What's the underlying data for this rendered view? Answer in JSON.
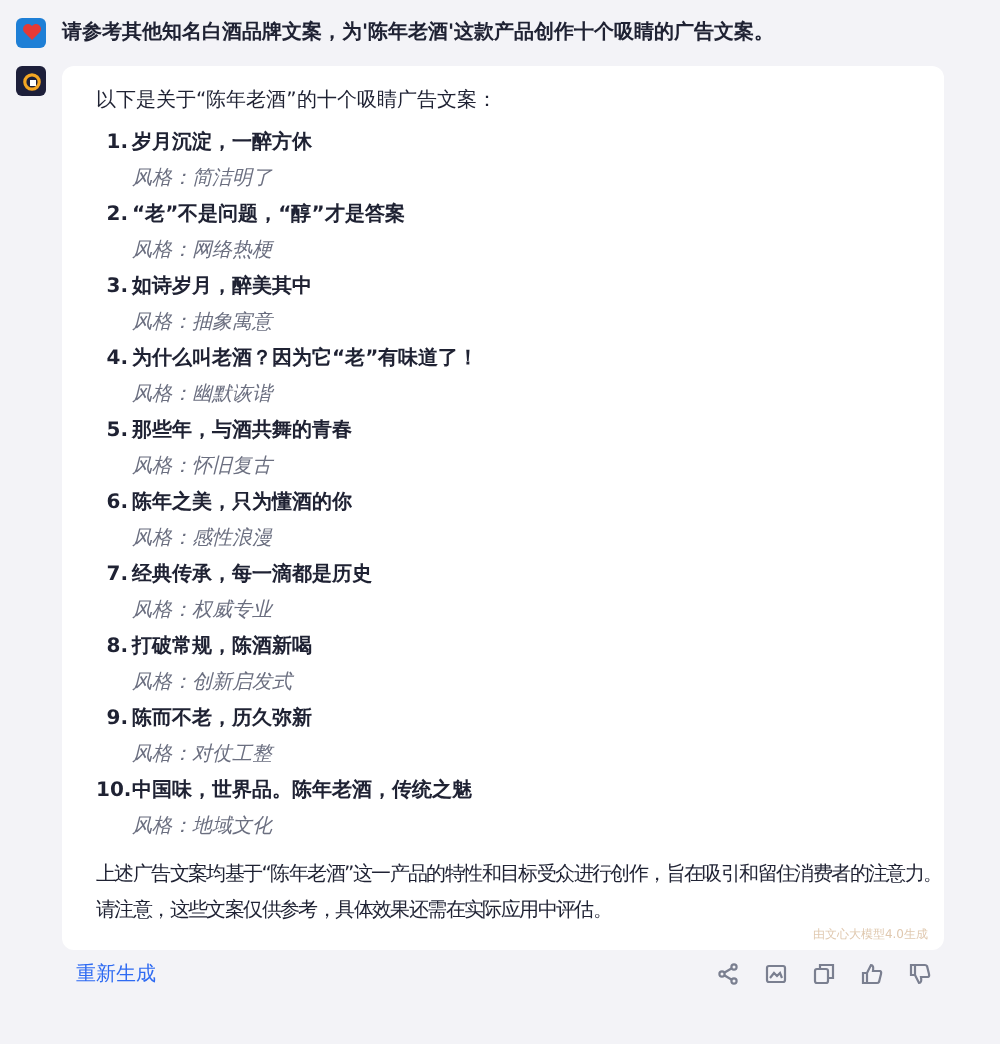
{
  "user_message": {
    "text": "请参考其他知名白酒品牌文案，为'陈年老酒'这款产品创作十个吸睛的广告文案。"
  },
  "reply": {
    "intro": "以下是关于“陈年老酒”的十个吸睛广告文案：",
    "items": [
      {
        "number": "1.",
        "title": "岁月沉淀，一醉方休",
        "style": "风格：简洁明了"
      },
      {
        "number": "2.",
        "title": "“老”不是问题，“醇”才是答案",
        "style": "风格：网络热梗"
      },
      {
        "number": "3.",
        "title": "如诗岁月，醉美其中",
        "style": "风格：抽象寓意"
      },
      {
        "number": "4.",
        "title": "为什么叫老酒？因为它“老”有味道了！",
        "style": "风格：幽默诙谐"
      },
      {
        "number": "5.",
        "title": "那些年，与酒共舞的青春",
        "style": "风格：怀旧复古"
      },
      {
        "number": "6.",
        "title": "陈年之美，只为懂酒的你",
        "style": "风格：感性浪漫"
      },
      {
        "number": "7.",
        "title": "经典传承，每一滴都是历史",
        "style": "风格：权威专业"
      },
      {
        "number": "8.",
        "title": "打破常规，陈酒新喝",
        "style": "风格：创新启发式"
      },
      {
        "number": "9.",
        "title": "陈而不老，历久弥新",
        "style": "风格：对仗工整"
      },
      {
        "number": "10.",
        "title": "中国味，世界品。陈年老酒，传统之魅",
        "style": "风格：地域文化"
      }
    ],
    "outro": [
      "上述广告文案均基于“陈年老酒”这一产品的特性和目标受众进行创作，旨在吸引和留住消费者的注意力。",
      "请注意，这些文案仅供参考，具体效果还需在实际应用中评估。"
    ],
    "generated_by": "由文心大模型4.0生成"
  },
  "actions": {
    "regenerate": "重新生成"
  }
}
